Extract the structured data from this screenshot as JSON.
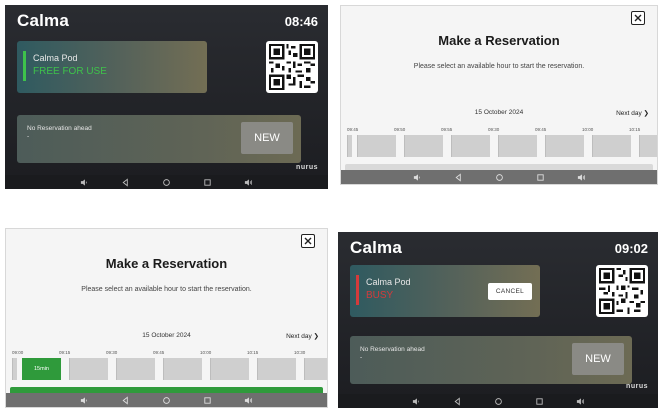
{
  "panels": [
    {
      "id": "home-free",
      "title": "Calma",
      "clock": "08:46",
      "pod": {
        "name": "Calma Pod",
        "status": "FREE FOR USE",
        "status_color": "#3ec24b"
      },
      "reservation": {
        "text": "No Reservation ahead",
        "dash": "-",
        "new_label": "NEW"
      },
      "brand": "nurus"
    },
    {
      "id": "reserve-empty",
      "title": "Make a Reservation",
      "subtitle": "Please select an available hour to start the reservation.",
      "date": "15 October 2024",
      "next_day": "Next day ❯",
      "times": [
        "09:45",
        "09:50",
        "09:55",
        "09:30",
        "09:45",
        "10:00",
        "10:15"
      ]
    },
    {
      "id": "reserve-selected",
      "title": "Make a Reservation",
      "subtitle": "Please select an available hour to start the reservation.",
      "date": "15 October 2024",
      "next_day": "Next day ❯",
      "times": [
        "09:00",
        "09:15",
        "09:30",
        "09:45",
        "10:00",
        "10:15",
        "10:30"
      ],
      "selected_slot_label": "15min"
    },
    {
      "id": "home-busy",
      "title": "Calma",
      "clock": "09:02",
      "pod": {
        "name": "Calma Pod",
        "status": "BUSY",
        "status_color": "#d33b3b",
        "cancel_label": "CANCEL"
      },
      "reservation": {
        "text": "No Reservation ahead",
        "dash": "-",
        "new_label": "NEW"
      },
      "brand": "nurus"
    }
  ],
  "colors": {
    "free_bar": "#3ec24b",
    "busy_bar": "#d33b3b",
    "selected_slot": "#2f9a3b"
  },
  "icons": [
    "volume-down-icon",
    "back-icon",
    "home-icon",
    "recents-icon",
    "volume-up-icon",
    "close-icon",
    "qr-code-icon"
  ]
}
